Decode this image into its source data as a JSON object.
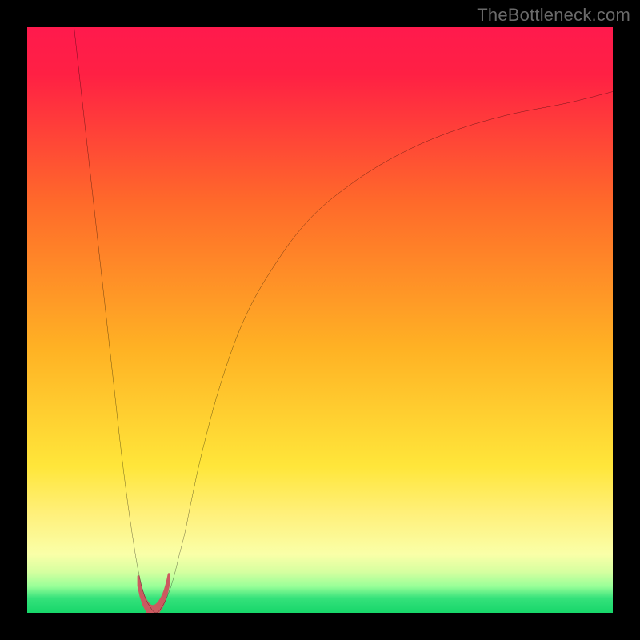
{
  "watermark": "TheBottleneck.com",
  "chart_data": {
    "type": "line",
    "title": "",
    "xlabel": "",
    "ylabel": "",
    "xlim": [
      0,
      100
    ],
    "ylim": [
      0,
      100
    ],
    "grid": false,
    "legend": false,
    "background": {
      "stops": [
        {
          "pos": 0.0,
          "color": "#ff1a4d"
        },
        {
          "pos": 0.08,
          "color": "#ff2044"
        },
        {
          "pos": 0.3,
          "color": "#ff6a2a"
        },
        {
          "pos": 0.55,
          "color": "#ffb224"
        },
        {
          "pos": 0.75,
          "color": "#ffe63a"
        },
        {
          "pos": 0.83,
          "color": "#fff07a"
        },
        {
          "pos": 0.9,
          "color": "#faffa8"
        },
        {
          "pos": 0.93,
          "color": "#d6ffa0"
        },
        {
          "pos": 0.955,
          "color": "#98ff98"
        },
        {
          "pos": 0.975,
          "color": "#35e27b"
        },
        {
          "pos": 1.0,
          "color": "#17d66a"
        }
      ]
    },
    "series": [
      {
        "name": "bottleneck-curve",
        "color": "#000000",
        "x": [
          8,
          9,
          10,
          11,
          12,
          13,
          14,
          15,
          16,
          17,
          18,
          19,
          20,
          21,
          22,
          23,
          24,
          25,
          26,
          27,
          28,
          30,
          33,
          37,
          42,
          48,
          55,
          63,
          72,
          82,
          92,
          100
        ],
        "y": [
          100,
          91,
          82,
          73,
          64,
          55,
          46,
          37,
          28,
          20,
          13,
          7,
          3,
          1,
          0,
          1,
          3,
          6,
          10,
          14,
          19,
          28,
          39,
          50,
          59,
          67,
          73,
          78,
          82,
          85,
          87,
          89
        ]
      },
      {
        "name": "confidence-band-foot",
        "color": "#cc5a60",
        "type": "area",
        "x": [
          19.0,
          19.4,
          19.9,
          20.5,
          21.1,
          21.8,
          22.4,
          23.0,
          23.5,
          23.9,
          24.2
        ],
        "y": [
          6.2,
          4.4,
          2.9,
          1.8,
          1.2,
          1.2,
          1.7,
          2.6,
          3.8,
          5.2,
          6.6
        ]
      }
    ]
  }
}
